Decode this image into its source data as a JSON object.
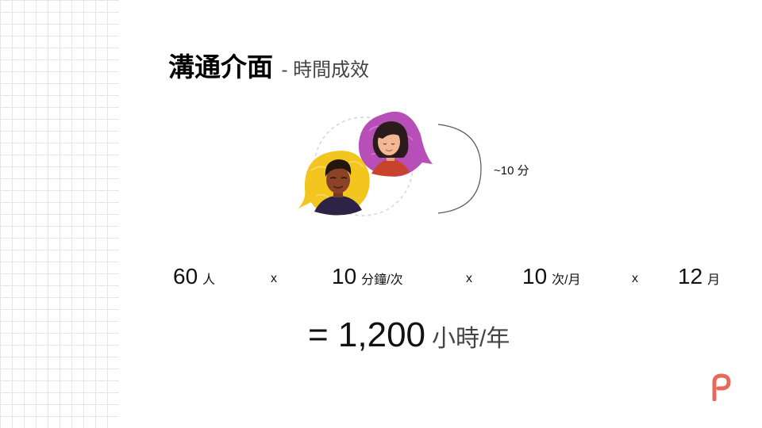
{
  "slide": {
    "title": "溝通介面",
    "subtitle": "- 時間成效",
    "duration_label": "~10 分",
    "calculation": {
      "people": {
        "value": "60",
        "unit": "人"
      },
      "minutes": {
        "value": "10",
        "unit": "分鐘/次"
      },
      "frequency": {
        "value": "10",
        "unit": "次/月"
      },
      "months": {
        "value": "12",
        "unit": "月"
      },
      "operator": "x"
    },
    "result": {
      "value": "= 1,200",
      "unit": "小時/年"
    }
  },
  "colors": {
    "accent_purple": "#b84fb8",
    "accent_yellow": "#f2c61f",
    "logo": "#e8685a"
  },
  "icons": {
    "avatar_man": "man-avatar-icon",
    "avatar_woman": "woman-avatar-icon",
    "logo": "brand-logo"
  }
}
